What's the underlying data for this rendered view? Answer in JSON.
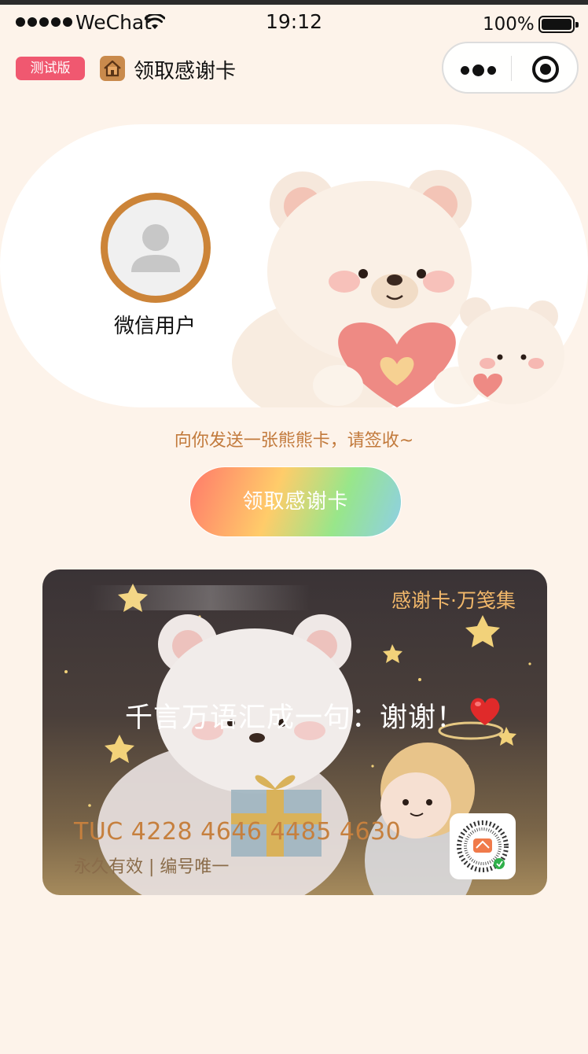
{
  "status_bar": {
    "carrier": "WeChat",
    "time": "19:12",
    "battery": "100%"
  },
  "nav": {
    "test_badge": "测试版",
    "title": "领取感谢卡"
  },
  "profile": {
    "username": "微信用户"
  },
  "invite_text": "向你发送一张熊熊卡，请签收~",
  "claim_button": "领取感谢卡",
  "card": {
    "brand": "感谢卡·万笺集",
    "message": "千言万语汇成一句：谢谢！",
    "number": "TUC 4228 4646 4485 4630",
    "validity": "永久有效 | 编号唯一"
  },
  "colors": {
    "background": "#fdf3ea",
    "accent": "#cc8438",
    "badge": "#f05870"
  }
}
